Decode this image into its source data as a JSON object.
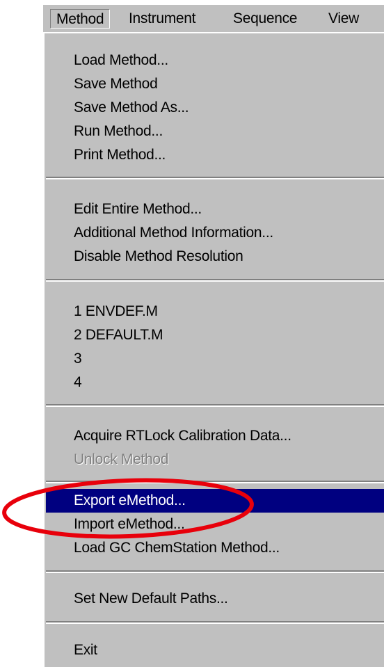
{
  "menubar": {
    "items": [
      "Method",
      "Instrument",
      "Sequence",
      "View"
    ]
  },
  "menu": {
    "groups": [
      [
        "Load Method...",
        "Save Method",
        "Save Method As...",
        "Run Method...",
        "Print Method..."
      ],
      [
        "Edit Entire Method...",
        "Additional Method Information...",
        "Disable Method Resolution"
      ],
      [
        "1 ENVDEF.M",
        "2 DEFAULT.M",
        "3",
        "4"
      ],
      [
        "Acquire RTLock Calibration Data...",
        "Unlock Method"
      ],
      [
        "Export eMethod...",
        "Import eMethod...",
        "Load GC ChemStation Method..."
      ],
      [
        "Set New Default Paths..."
      ],
      [
        "Exit"
      ]
    ],
    "highlighted_item": "Export eMethod...",
    "disabled_item": "Unlock Method"
  },
  "colors": {
    "menu_background": "#c0c0c0",
    "highlight": "#000080",
    "annotation_circle": "#e8000b"
  }
}
